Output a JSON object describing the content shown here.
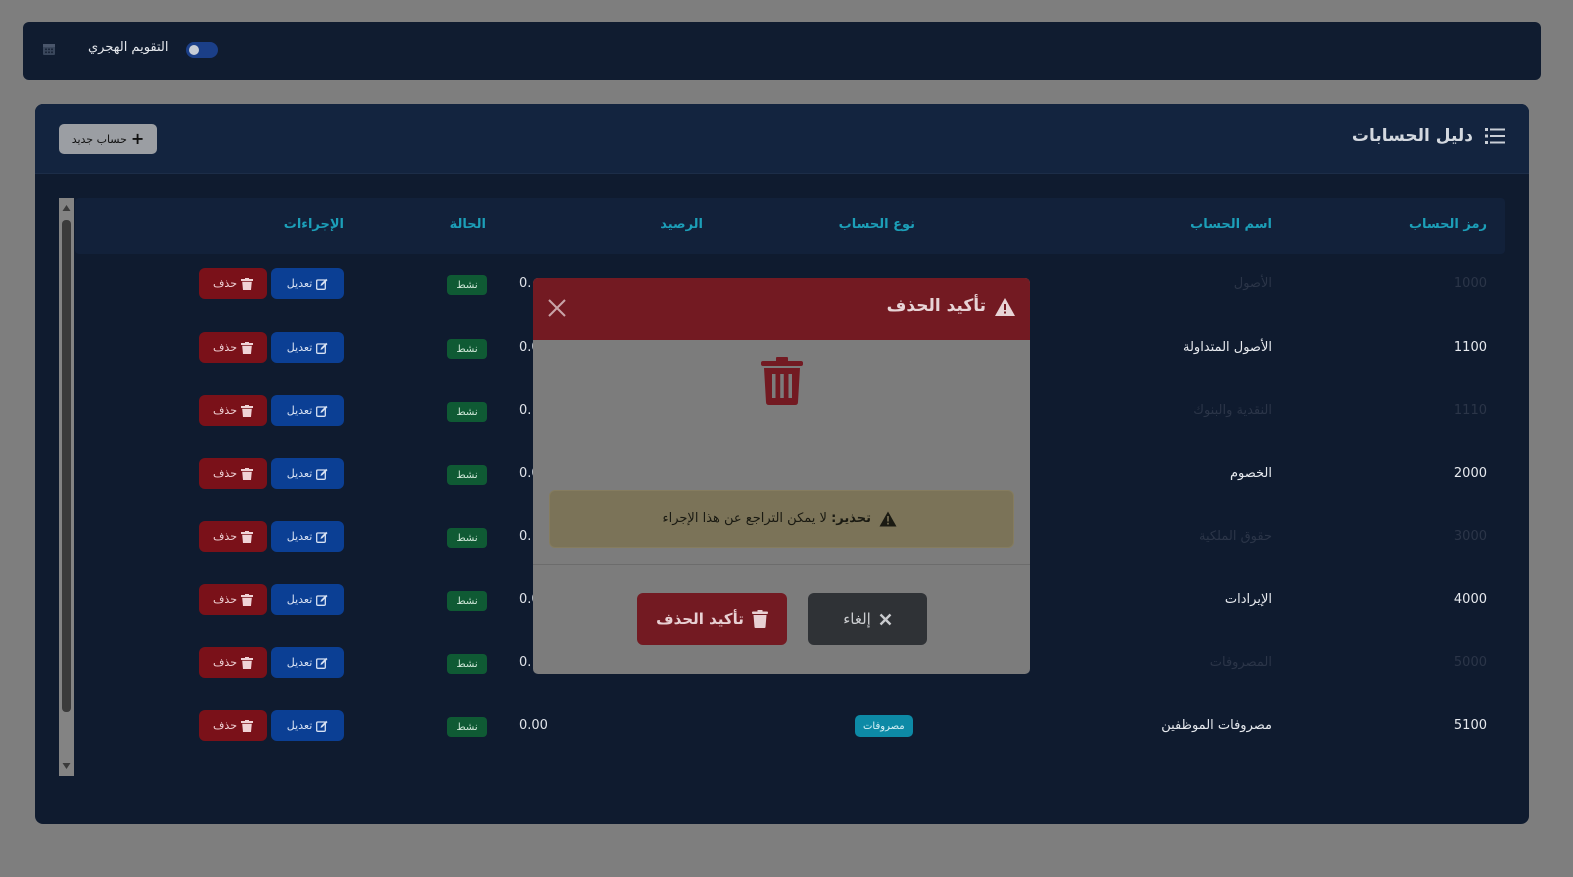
{
  "topbar": {
    "hijri_label": "التقويم الهجري",
    "hijri_toggle_on": false
  },
  "card": {
    "title": "دليل الحسابات",
    "new_button_label": "حساب جديد"
  },
  "table": {
    "headers": {
      "code": "رمز الحساب",
      "name": "اسم الحساب",
      "type": "نوع الحساب",
      "balance": "الرصيد",
      "status": "الحالة",
      "actions": "الإجراءات"
    },
    "rows": [
      {
        "code": "1000",
        "name": "الأصول",
        "balance": "0.",
        "status": "نشط",
        "type": ""
      },
      {
        "code": "1100",
        "name": "الأصول المتداولة",
        "balance": "0.0",
        "status": "نشط",
        "type": ""
      },
      {
        "code": "1110",
        "name": "النقدية والبنوك",
        "balance": "0.",
        "status": "نشط",
        "type": ""
      },
      {
        "code": "2000",
        "name": "الخصوم",
        "balance": "0.0",
        "status": "نشط",
        "type": ""
      },
      {
        "code": "3000",
        "name": "حقوق الملكية",
        "balance": "0.",
        "status": "نشط",
        "type": ""
      },
      {
        "code": "4000",
        "name": "الإيرادات",
        "balance": "0.0",
        "status": "نشط",
        "type": ""
      },
      {
        "code": "5000",
        "name": "المصروفات",
        "balance": "0.",
        "status": "نشط",
        "type": ""
      },
      {
        "code": "5100",
        "name": "مصروفات الموظفين",
        "balance": "0.00",
        "status": "نشط",
        "type": "مصروفات"
      }
    ],
    "edit_label": "تعديل",
    "delete_label": "حذف"
  },
  "modal": {
    "title": "تأكيد الحذف",
    "warning_bold": "تحذير:",
    "warning_text": " لا يمكن التراجع عن هذا الإجراء",
    "cancel_label": "إلغاء",
    "confirm_label": "تأكيد الحذف"
  },
  "colors": {
    "danger": "#731a22",
    "primary": "#0b3f94",
    "success": "#0f5a34",
    "info": "#0d8aa6",
    "header_text": "#1c9fb8"
  }
}
